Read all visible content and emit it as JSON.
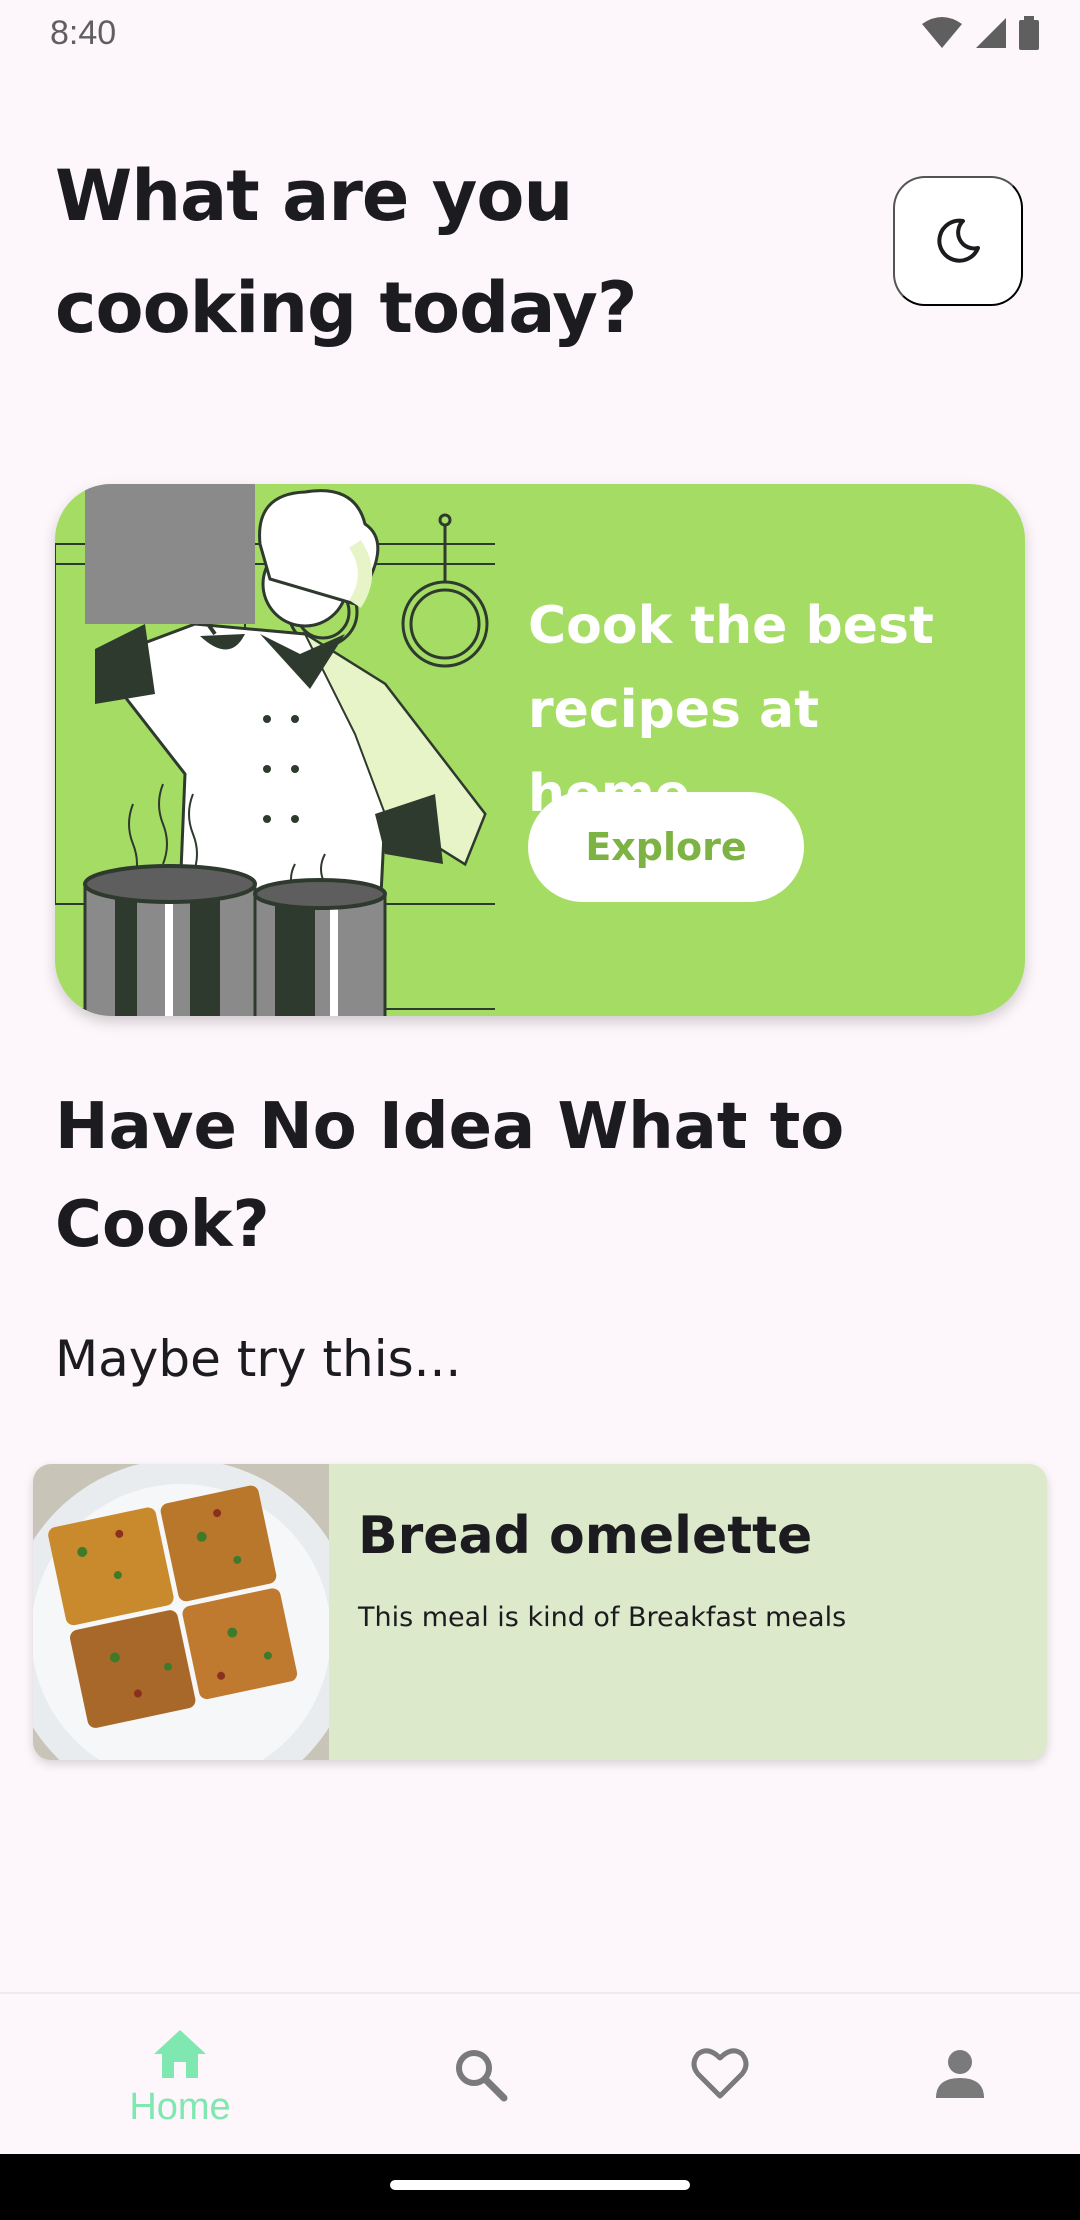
{
  "status_bar": {
    "time": "8:40"
  },
  "header": {
    "headline": "What are you cooking today?",
    "theme_toggle_icon": "moon-icon"
  },
  "banner": {
    "title": "Cook the best recipes at home",
    "button_label": "Explore",
    "background_color": "#a5dc64"
  },
  "suggestion": {
    "title": "Have No Idea What to Cook?",
    "subtitle": "Maybe try this...",
    "meal": {
      "name": "Bread omelette",
      "description": "This meal is kind of Breakfast meals"
    }
  },
  "bottom_nav": {
    "items": [
      {
        "label": "Home",
        "icon": "home-icon",
        "active": true
      },
      {
        "label": "",
        "icon": "search-icon",
        "active": false
      },
      {
        "label": "",
        "icon": "heart-icon",
        "active": false
      },
      {
        "label": "",
        "icon": "person-icon",
        "active": false
      }
    ],
    "active_color": "#7ee8b0"
  }
}
